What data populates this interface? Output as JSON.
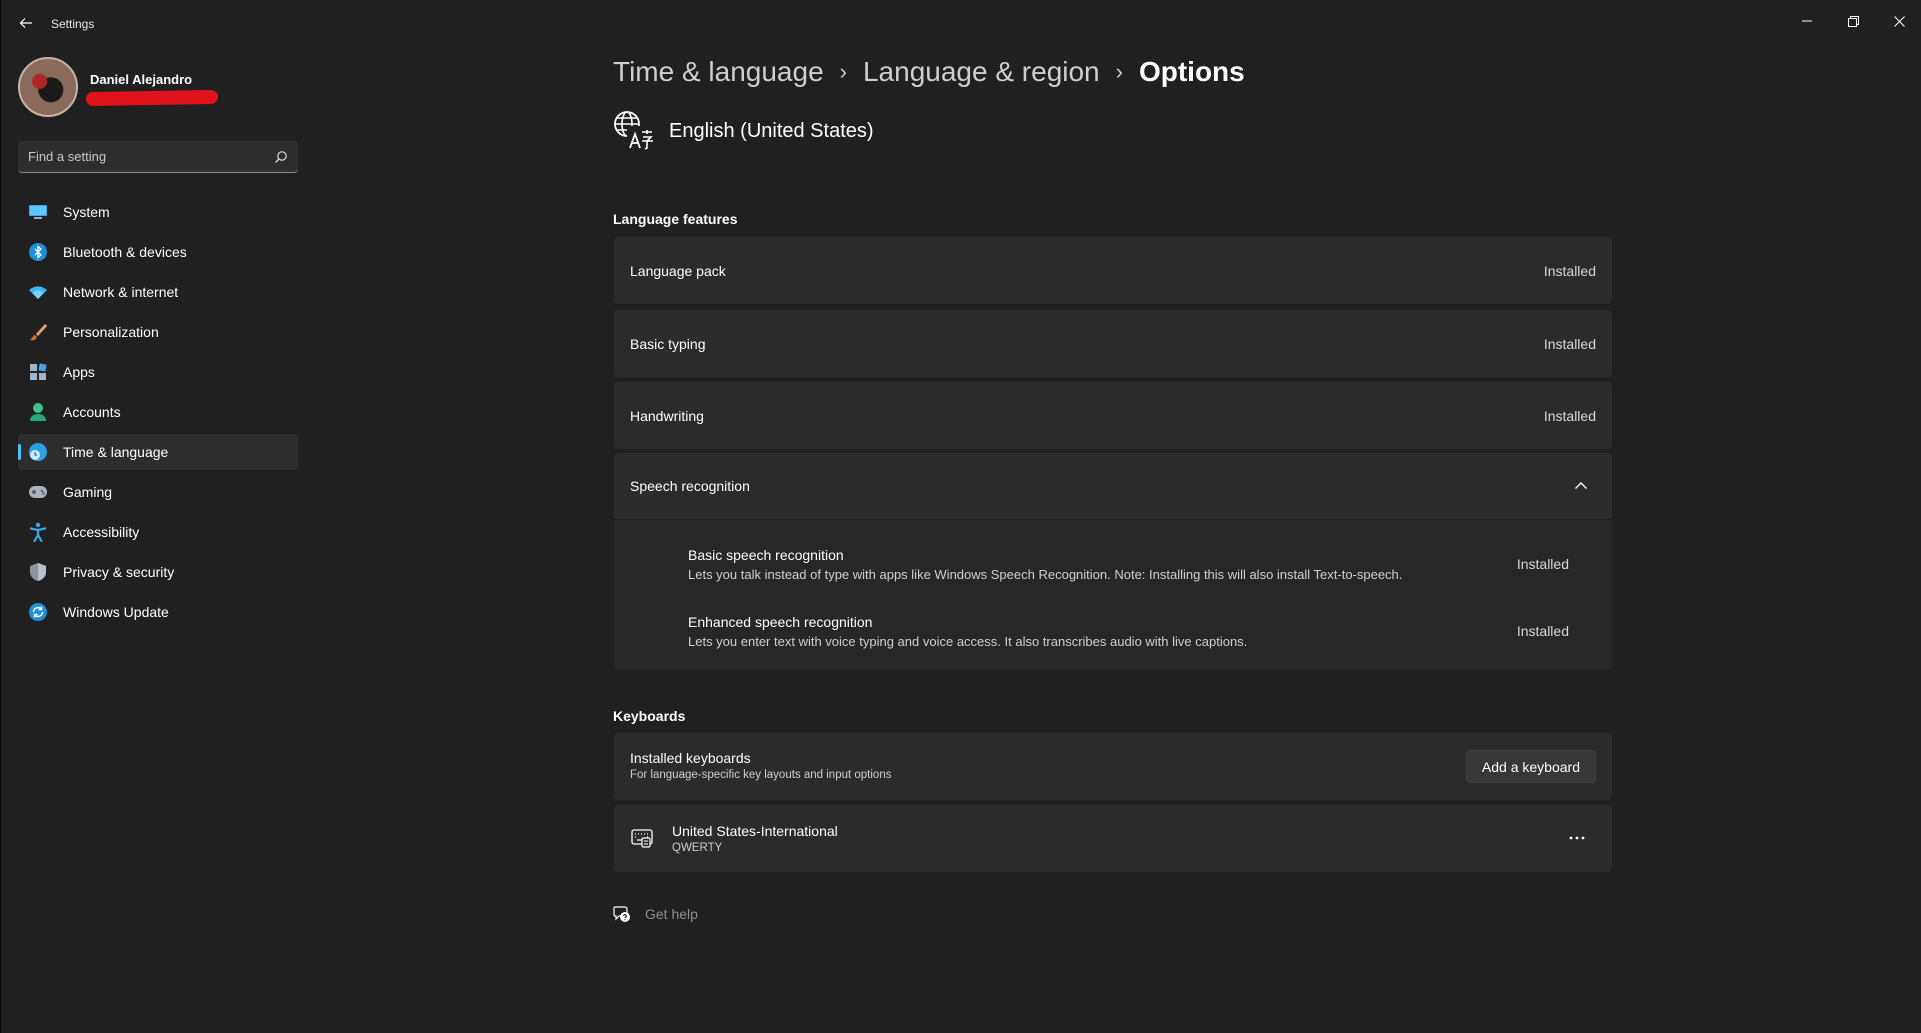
{
  "window": {
    "title": "Settings"
  },
  "user": {
    "name": "Daniel Alejandro"
  },
  "search": {
    "placeholder": "Find a setting"
  },
  "sidebar": {
    "items": [
      {
        "label": "System",
        "icon": "system-icon"
      },
      {
        "label": "Bluetooth & devices",
        "icon": "bluetooth-icon"
      },
      {
        "label": "Network & internet",
        "icon": "wifi-icon"
      },
      {
        "label": "Personalization",
        "icon": "brush-icon"
      },
      {
        "label": "Apps",
        "icon": "apps-icon"
      },
      {
        "label": "Accounts",
        "icon": "accounts-icon"
      },
      {
        "label": "Time & language",
        "icon": "time-language-icon",
        "active": true
      },
      {
        "label": "Gaming",
        "icon": "gamepad-icon"
      },
      {
        "label": "Accessibility",
        "icon": "accessibility-icon"
      },
      {
        "label": "Privacy & security",
        "icon": "shield-icon"
      },
      {
        "label": "Windows Update",
        "icon": "update-icon"
      }
    ]
  },
  "breadcrumb": {
    "items": [
      "Time & language",
      "Language & region",
      "Options"
    ],
    "separator": "›"
  },
  "language": {
    "title": "English (United States)"
  },
  "language_features": {
    "heading": "Language features",
    "rows": [
      {
        "label": "Language pack",
        "status": "Installed"
      },
      {
        "label": "Basic typing",
        "status": "Installed"
      },
      {
        "label": "Handwriting",
        "status": "Installed"
      }
    ],
    "speech": {
      "label": "Speech recognition",
      "expanded": true,
      "items": [
        {
          "title": "Basic speech recognition",
          "description": "Lets you talk instead of type with apps like Windows Speech Recognition. Note: Installing this will also install Text-to-speech.",
          "status": "Installed"
        },
        {
          "title": "Enhanced speech recognition",
          "description": "Lets you enter text with voice typing and voice access. It also transcribes audio with live captions.",
          "status": "Installed"
        }
      ]
    }
  },
  "keyboards": {
    "heading": "Keyboards",
    "installed": {
      "title": "Installed keyboards",
      "subtitle": "For language-specific key layouts and input options",
      "button": "Add a keyboard"
    },
    "items": [
      {
        "name": "United States-International",
        "layout": "QWERTY"
      }
    ]
  },
  "help": {
    "label": "Get help"
  },
  "colors": {
    "background": "#202020",
    "card": "#2b2b2b",
    "accent": "#4cc2ff",
    "redaction": "#e0131b"
  }
}
